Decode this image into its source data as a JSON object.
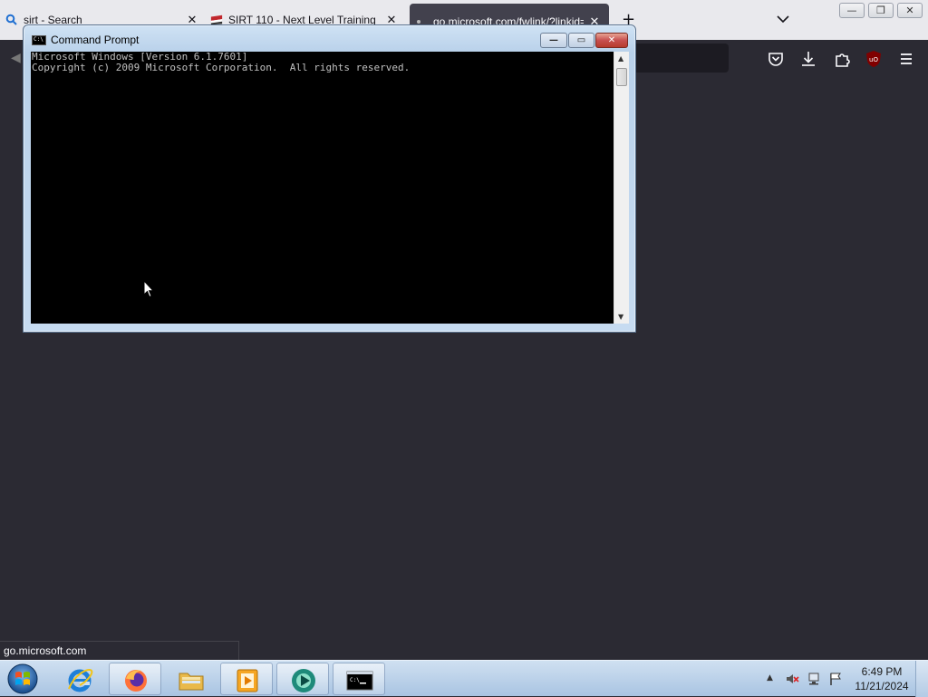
{
  "browser": {
    "tabs": [
      {
        "label": "sirt - Search",
        "close": "✕"
      },
      {
        "label": "SIRT 110 - Next Level Training",
        "close": "✕"
      },
      {
        "label": "go.microsoft.com/fwlink/?linkid=",
        "close": "✕"
      }
    ],
    "new_tab": "+",
    "status_url": "go.microsoft.com",
    "colors": {
      "chrome_bg": "#2b2a33",
      "tab_strip": "#e9e9ed",
      "active_tab": "#42414d"
    }
  },
  "cmd": {
    "title": "Command Prompt",
    "icon_text": "C:\\",
    "lines": [
      "Microsoft Windows [Version 6.1.7601]",
      "Copyright (c) 2009 Microsoft Corporation.  All rights reserved."
    ],
    "buttons": {
      "minimize": "—",
      "maximize": "▭",
      "close": "✕"
    }
  },
  "taskbar": {
    "pinned_apps": [
      "start-orb",
      "internet-explorer-icon",
      "firefox-icon",
      "file-explorer-icon",
      "media-player-icon",
      "greenshot-icon",
      "command-prompt-icon"
    ],
    "clock": {
      "time": "6:49 PM",
      "date": "11/21/2024"
    },
    "tray_arrow": "▲"
  }
}
